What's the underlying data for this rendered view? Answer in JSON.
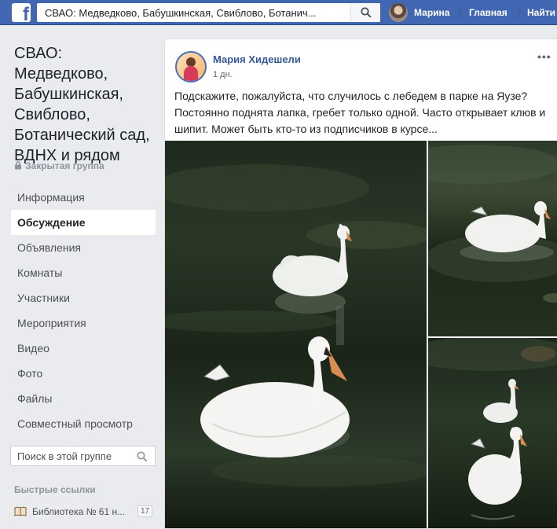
{
  "topbar": {
    "search_text": "СВАО: Медведково, Бабушкинская, Свиблово, Ботанич...",
    "user_name": "Марина",
    "home_label": "Главная",
    "find_label": "Найти"
  },
  "group": {
    "title": "СВАО: Медведково, Бабушкинская, Свиблово, Ботанический сад, ВДНХ и рядом",
    "privacy": "Закрытая группа"
  },
  "menu": [
    {
      "label": "Информация",
      "active": false
    },
    {
      "label": "Обсуждение",
      "active": true
    },
    {
      "label": "Объявления",
      "active": false
    },
    {
      "label": "Комнаты",
      "active": false
    },
    {
      "label": "Участники",
      "active": false
    },
    {
      "label": "Мероприятия",
      "active": false
    },
    {
      "label": "Видео",
      "active": false
    },
    {
      "label": "Фото",
      "active": false
    },
    {
      "label": "Файлы",
      "active": false
    },
    {
      "label": "Совместный просмотр",
      "active": false
    }
  ],
  "group_search": {
    "placeholder": "Поиск в этой группе"
  },
  "quick_links": {
    "title": "Быстрые ссылки",
    "items": [
      {
        "label": "Библиотека № 61 н...",
        "count": "17"
      }
    ]
  },
  "post": {
    "author": "Мария Хидешели",
    "time": "1 дн.",
    "text": "Подскажите, пожалуйста, что случилось с лебедем в парке на Яузе? Постоянно поднята лапка, гребет только одной. Часто открывает клюв и шипит. Может быть кто-то из подписчиков в курсе..."
  },
  "icons": {
    "logo": "facebook-logo-icon",
    "search": "search-icon",
    "lock": "lock-icon",
    "book": "book-icon",
    "more": "more-options-icon"
  },
  "colors": {
    "brand": "#4267b2",
    "link": "#365899",
    "background": "#e9ebee"
  }
}
